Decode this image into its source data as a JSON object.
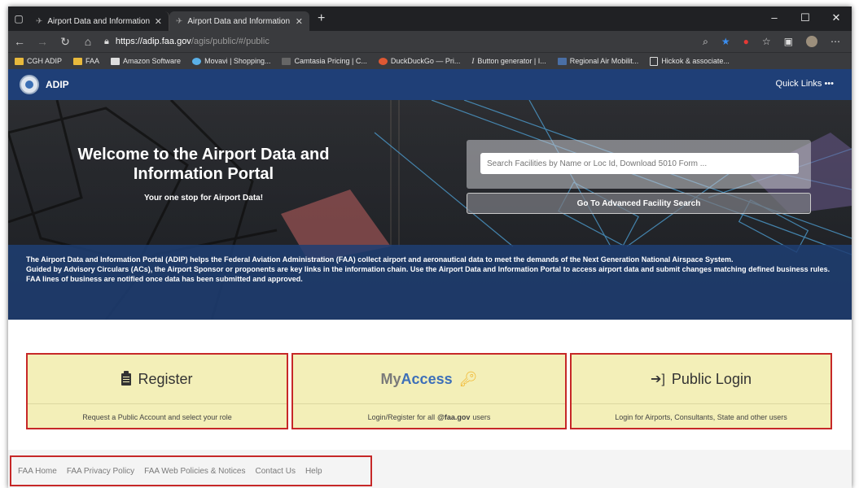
{
  "browser": {
    "tabs": [
      {
        "title": "Airport Data and Information Po",
        "active": false
      },
      {
        "title": "Airport Data and Information Po",
        "active": true
      }
    ],
    "new_tab_label": "+",
    "url_domain": "https://adip.faa.gov",
    "url_path": "/agis/public/#/public",
    "bookmarks": [
      {
        "label": "CGH ADIP",
        "icon": "folder-icon"
      },
      {
        "label": "FAA",
        "icon": "folder-icon"
      },
      {
        "label": "Amazon Software",
        "icon": "amazon-icon"
      },
      {
        "label": "Movavi | Shopping...",
        "icon": "movavi-icon"
      },
      {
        "label": "Camtasia Pricing | C...",
        "icon": "camtasia-icon"
      },
      {
        "label": "DuckDuckGo — Pri...",
        "icon": "duckduckgo-icon"
      },
      {
        "label": "Button generator | I...",
        "icon": "italic-icon"
      },
      {
        "label": "Regional Air Mobilit...",
        "icon": "plane-icon"
      },
      {
        "label": "Hickok & associate...",
        "icon": "page-icon"
      }
    ]
  },
  "header": {
    "brand": "ADIP",
    "quick_links": "Quick Links •••"
  },
  "hero": {
    "title": "Welcome to the Airport Data and Information Portal",
    "subtitle": "Your one stop for Airport Data!",
    "search_placeholder": "Search Facilities by Name or Loc Id, Download 5010 Form ...",
    "advanced_search": "Go To Advanced Facility Search",
    "info_p1": "The Airport Data and Information Portal (ADIP) helps the Federal Aviation Administration (FAA) collect airport and aeronautical data to meet the demands of the Next Generation National Airspace System.",
    "info_p2": "Guided by Advisory Circulars (ACs), the Airport Sponsor or proponents are key links in the information chain. Use the Airport Data and Information Portal to access airport data and submit changes matching defined business rules. FAA lines of business are notified once data has been submitted and approved."
  },
  "cards": {
    "register": {
      "title": "Register",
      "desc": "Request a Public Account and select your role"
    },
    "myaccess": {
      "title_my": "My",
      "title_access": "Access",
      "desc": "Login/Register for all",
      "desc_bold": "@faa.gov",
      "desc_tail": "users"
    },
    "public_login": {
      "title": "Public Login",
      "desc": "Login for Airports, Consultants, State and other users"
    }
  },
  "footer": {
    "links": [
      "FAA Home",
      "FAA Privacy Policy",
      "FAA Web Policies & Notices",
      "Contact Us",
      "Help"
    ]
  },
  "colors": {
    "header_blue": "#1f3f77",
    "card_yellow": "#f3efb8",
    "highlight_red": "#c62828",
    "access_blue": "#3d6fb8",
    "key_gold": "#f2b52a"
  }
}
